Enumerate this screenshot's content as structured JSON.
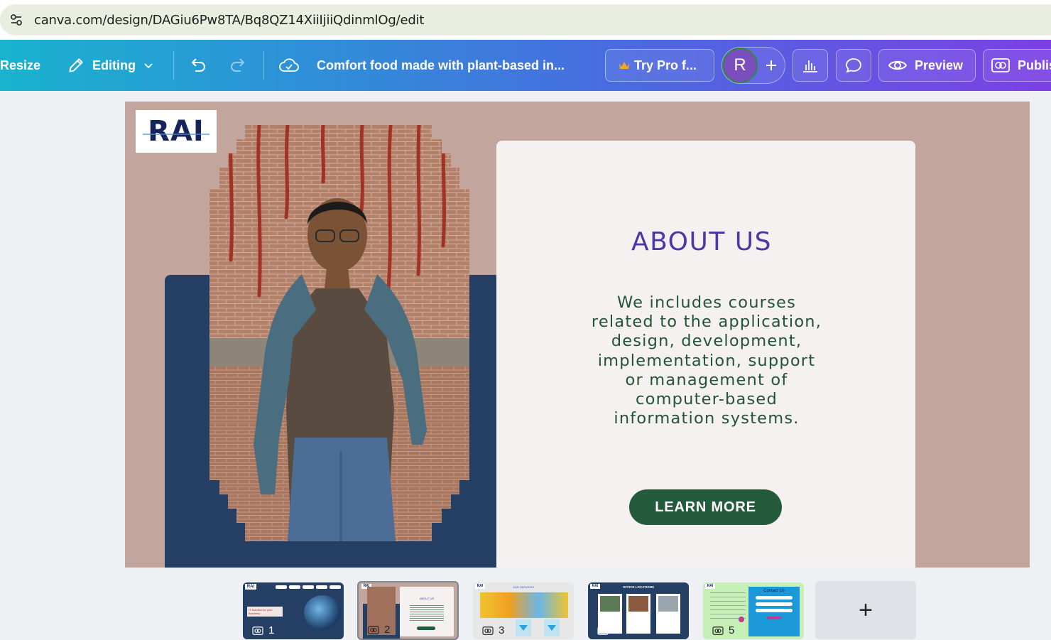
{
  "browser": {
    "url": "canva.com/design/DAGiu6Pw8TA/Bq8QZ14XiiIjiiQdinmlOg/edit"
  },
  "toolbar": {
    "resize_label": "Resize",
    "editing_label": "Editing",
    "design_title": "Comfort food made with plant-based in...",
    "try_pro_label": "Try Pro f...",
    "avatar_initial": "R",
    "preview_label": "Preview",
    "publish_label": "Publis"
  },
  "slide": {
    "logo_text": "RAI",
    "title": "ABOUT US",
    "body": "We includes courses related to the application, design, development, implementation, support or management of computer-based information systems.",
    "button_label": "LEARN MORE",
    "colors": {
      "background": "#c2a59c",
      "navy": "#243f63",
      "card": "#f6f1f1",
      "title": "#4b37a6",
      "body": "#235338",
      "button": "#245b3c"
    }
  },
  "pages": [
    {
      "number": "1",
      "selected": false
    },
    {
      "number": "2",
      "selected": true
    },
    {
      "number": "3",
      "selected": false
    },
    {
      "number": "4",
      "selected": false
    },
    {
      "number": "5",
      "selected": false
    }
  ],
  "thumb_texts": {
    "p2_title": "ABOUT US",
    "p3_title": "OUR SERVICES",
    "p4_title": "OFFICE LOCATIONS",
    "p5_title": "Contact Us",
    "p1_banner": "IT Solution for your Business"
  },
  "add_page_label": "+"
}
